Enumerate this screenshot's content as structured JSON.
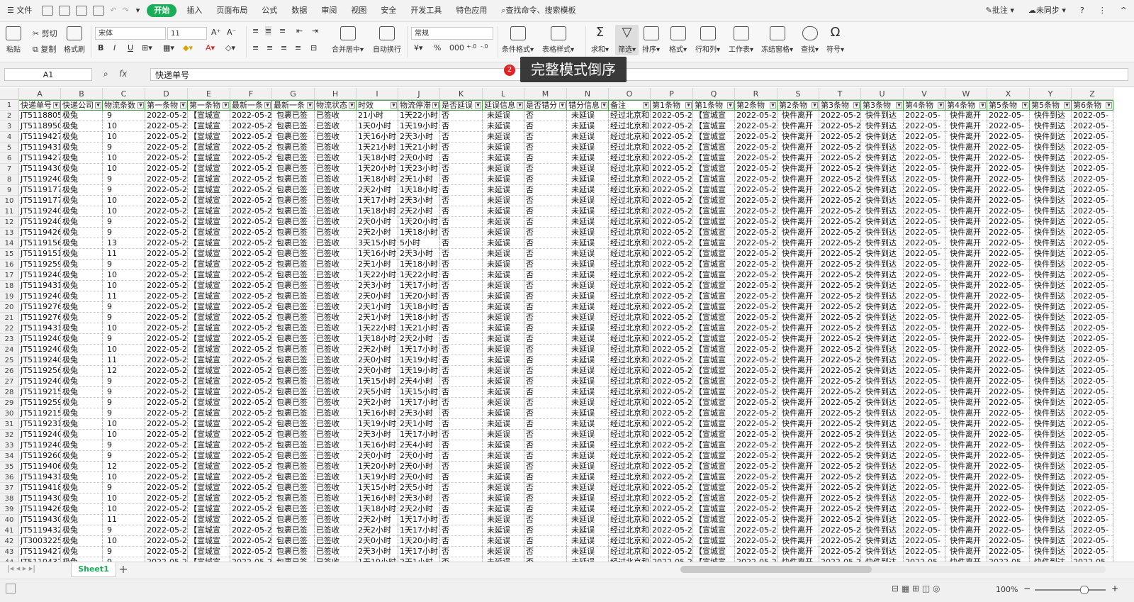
{
  "menubar": {
    "file": "文件",
    "tabs": [
      "开始",
      "插入",
      "页面布局",
      "公式",
      "数据",
      "审阅",
      "视图",
      "安全",
      "开发工具",
      "特色应用"
    ],
    "search": "查找命令、搜索模板",
    "comment": "批注",
    "sync": "未同步"
  },
  "ribbon": {
    "paste": "粘贴",
    "cut": "剪切",
    "copy": "复制",
    "format_painter": "格式刷",
    "font_name": "宋体",
    "font_size": "11",
    "merge": "合并居中",
    "wrap": "自动换行",
    "number_format": "常规",
    "cond_format": "条件格式",
    "table_style": "表格样式",
    "sum": "求和",
    "filter": "筛选",
    "sort": "排序",
    "format": "格式",
    "rowcol": "行和列",
    "worksheet": "工作表",
    "freeze": "冻结窗格",
    "find": "查找",
    "symbol": "符号",
    "bold": "B",
    "italic": "I",
    "underline": "U"
  },
  "formula_bar": {
    "name_box": "A1",
    "fx": "fx",
    "content": "快递单号"
  },
  "tooltip": {
    "badge": "2",
    "text": "完整模式倒序"
  },
  "sheet": {
    "col_letters": [
      "A",
      "B",
      "C",
      "D",
      "E",
      "F",
      "G",
      "H",
      "I",
      "J",
      "K",
      "L",
      "M",
      "N",
      "O",
      "P",
      "Q",
      "R",
      "S",
      "T",
      "U",
      "V",
      "W",
      "X",
      "Y",
      "Z"
    ],
    "headers": [
      "快递单号",
      "快递公司",
      "物流条数",
      "第一条物",
      "第一条物",
      "最新一条",
      "最新一条",
      "物流状态",
      "时效",
      "物流停滞",
      "是否延误",
      "延误信息",
      "是否错分",
      "错分信息",
      "备注",
      "第1条物",
      "第1条物",
      "第2条物",
      "第2条物",
      "第3条物",
      "第3条物",
      "第4条物",
      "第4条物",
      "第5条物",
      "第5条物",
      "第6条物"
    ],
    "row_numbers": [
      "1",
      "2",
      "3",
      "4",
      "5",
      "6",
      "7",
      "8",
      "9",
      "10",
      "11",
      "12",
      "13",
      "14",
      "15",
      "16",
      "17",
      "18",
      "19",
      "20",
      "21",
      "22",
      "23",
      "24",
      "25",
      "26",
      "27",
      "28",
      "29",
      "30",
      "31",
      "32",
      "33",
      "34",
      "35",
      "36",
      "37",
      "38",
      "39",
      "40",
      "41",
      "42",
      "43",
      "44"
    ],
    "ids": [
      "JT5118805",
      "JT5118950",
      "JT5119427",
      "JT5119431",
      "JT5119427",
      "JT5119430",
      "JT5119240",
      "JT5119177",
      "JT5119177",
      "JT5119240",
      "JT5119240",
      "JT5119426",
      "JT5119156",
      "JT5119151",
      "JT5119259",
      "JT5119240",
      "JT5119431",
      "JT5119240",
      "JT5119276",
      "JT5119276",
      "JT5119431",
      "JT5119240",
      "JT5119240",
      "JT5119240",
      "JT5119256",
      "JT5119240",
      "JT5119215",
      "JT5119259",
      "JT5119215",
      "JT5119231",
      "JT5119240",
      "JT5119240",
      "JT5119260",
      "JT5119406",
      "JT5119431",
      "JT5119418",
      "JT5119430",
      "JT5119426",
      "JT5119430",
      "JT5119432",
      "JT3003225",
      "JT5119427",
      "JT5119432"
    ],
    "counts": [
      "9",
      "10",
      "10",
      "9",
      "10",
      "10",
      "9",
      "9",
      "10",
      "10",
      "9",
      "9",
      "13",
      "11",
      "9",
      "10",
      "10",
      "11",
      "9",
      "9",
      "10",
      "9",
      "10",
      "11",
      "12",
      "9",
      "9",
      "9",
      "9",
      "10",
      "10",
      "9",
      "9",
      "12",
      "10",
      "9",
      "10",
      "10",
      "11",
      "9",
      "10",
      "9",
      "9"
    ],
    "timeliness": [
      "21小时",
      "1天0小时",
      "1天16小时",
      "1天21小时",
      "1天18小时",
      "1天20小时",
      "1天18小时",
      "2天2小时",
      "1天17小时",
      "1天18小时",
      "2天0小时",
      "2天2小时",
      "3天15小时",
      "1天16小时",
      "2天1小时",
      "1天22小时",
      "2天3小时",
      "2天0小时",
      "2天1小时",
      "2天1小时",
      "1天22小时",
      "1天18小时",
      "2天2小时",
      "2天0小时",
      "2天0小时",
      "1天15小时",
      "2天5小时",
      "2天2小时",
      "1天16小时",
      "1天19小时",
      "2天3小时",
      "1天16小时",
      "2天0小时",
      "1天20小时",
      "1天19小时",
      "1天15小时",
      "1天16小时",
      "1天18小时",
      "2天2小时",
      "2天2小时",
      "2天0小时",
      "2天3小时",
      "1天19小时"
    ],
    "stagnation": [
      "1天22小时",
      "1天19小时",
      "2天3小时",
      "1天21小时",
      "2天0小时",
      "1天23小时",
      "2天1小时",
      "1天18小时",
      "2天3小时",
      "2天2小时",
      "1天20小时",
      "1天18小时",
      "5小时",
      "2天3小时",
      "1天18小时",
      "1天22小时",
      "1天17小时",
      "1天20小时",
      "1天18小时",
      "1天18小时",
      "1天21小时",
      "2天2小时",
      "1天17小时",
      "1天19小时",
      "1天19小时",
      "2天4小时",
      "1天15小时",
      "1天17小时",
      "2天3小时",
      "2天1小时",
      "1天17小时",
      "2天4小时",
      "2天0小时",
      "2天0小时",
      "2天0小时",
      "2天5小时",
      "2天3小时",
      "2天2小时",
      "1天17小时",
      "1天17小时",
      "1天20小时",
      "1天17小时",
      "2天1小时"
    ],
    "fixed": {
      "company": "极兔",
      "date": "2022-05-2",
      "date2": "2022-05-",
      "location": "【宣城宣",
      "signed_pkg": "包裹已签",
      "status": "已签收",
      "no": "否",
      "not_delayed": "未延误",
      "not_mis": "未延误",
      "remark": "经过北京和",
      "left": "快件离开",
      "arrive": "快件到达"
    }
  },
  "sheetbar": {
    "tab": "Sheet1",
    "add": "+"
  },
  "statusbar": {
    "zoom": "100%"
  }
}
